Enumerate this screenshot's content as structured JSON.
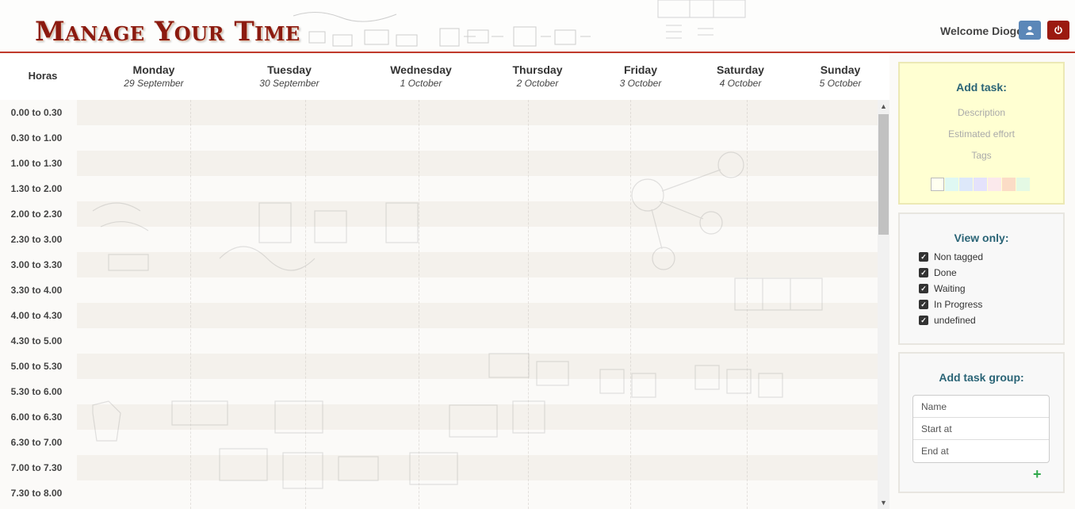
{
  "header": {
    "logo": "Manage Your Time",
    "welcome": "Welcome Diogo",
    "icons": {
      "user": "user-icon",
      "power": "power-icon"
    },
    "colors": {
      "accent": "#8b1a10",
      "user_button": "#5b87b8",
      "power_button": "#9b1a10",
      "divider": "#c0392b"
    }
  },
  "calendar": {
    "hours_header": "Horas",
    "days": [
      {
        "name": "Monday",
        "date": "29 September"
      },
      {
        "name": "Tuesday",
        "date": "30 September"
      },
      {
        "name": "Wednesday",
        "date": "1 October"
      },
      {
        "name": "Thursday",
        "date": "2 October"
      },
      {
        "name": "Friday",
        "date": "3 October"
      },
      {
        "name": "Saturday",
        "date": "4 October"
      },
      {
        "name": "Sunday",
        "date": "5 October"
      }
    ],
    "hours": [
      "0.00 to 0.30",
      "0.30 to 1.00",
      "1.00 to 1.30",
      "1.30 to 2.00",
      "2.00 to 2.30",
      "2.30 to 3.00",
      "3.00 to 3.30",
      "3.30 to 4.00",
      "4.00 to 4.30",
      "4.30 to 5.00",
      "5.00 to 5.30",
      "5.30 to 6.00",
      "6.00 to 6.30",
      "6.30 to 7.00",
      "7.00 to 7.30",
      "7.30 to 8.00"
    ]
  },
  "add_task": {
    "title": "Add task:",
    "description_placeholder": "Description",
    "effort_placeholder": "Estimated effort",
    "tags_placeholder": "Tags",
    "colors": [
      "#fffff0",
      "#dff8f3",
      "#dde8fa",
      "#e4e2fb",
      "#fbe9ec",
      "#fbdcc6",
      "#e4f9e4"
    ]
  },
  "view_only": {
    "title": "View only:",
    "items": [
      "Non tagged",
      "Done",
      "Waiting",
      "In Progress",
      "undefined"
    ]
  },
  "add_task_group": {
    "title": "Add task group:",
    "name_placeholder": "Name",
    "start_placeholder": "Start at",
    "end_placeholder": "End at",
    "add_icon": "plus-icon"
  }
}
